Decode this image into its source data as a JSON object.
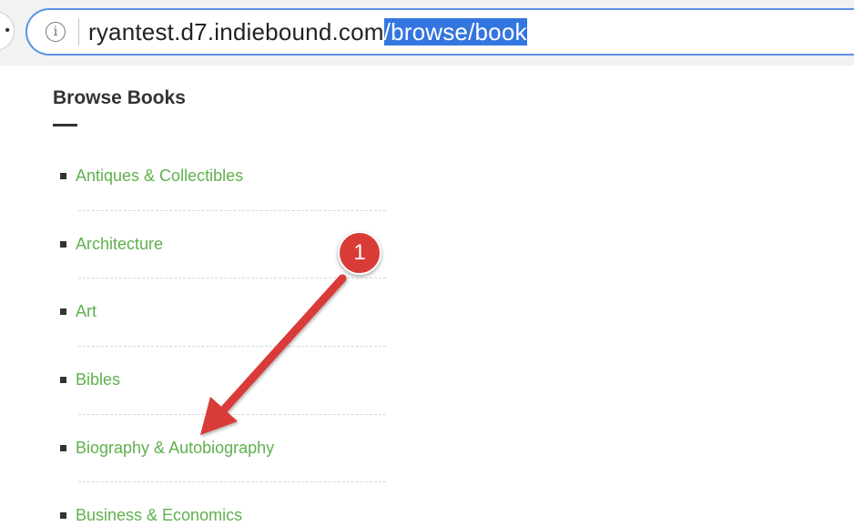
{
  "browser": {
    "back_glyph": "•",
    "info_glyph": "i",
    "url_host": "ryantest.d7.indiebound.com",
    "url_path_selected": "/browse/book"
  },
  "page": {
    "title": "Browse Books"
  },
  "categories": [
    {
      "label": "Antiques & Collectibles"
    },
    {
      "label": "Architecture"
    },
    {
      "label": "Art"
    },
    {
      "label": "Bibles"
    },
    {
      "label": "Biography & Autobiography"
    },
    {
      "label": "Business & Economics"
    }
  ],
  "annotation": {
    "step_number": "1",
    "color": "#d93b37",
    "points_to": "Biography & Autobiography"
  },
  "colors": {
    "link": "#60b04d",
    "address_focus": "#5b93e6",
    "selection": "#3476e0"
  }
}
